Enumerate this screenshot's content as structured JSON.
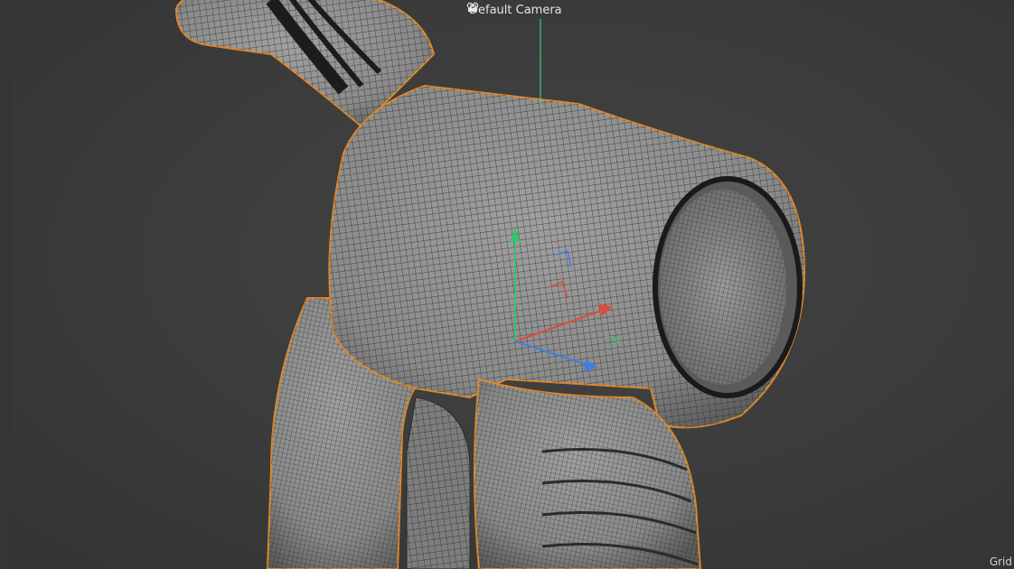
{
  "viewport": {
    "camera_label": "Default Camera",
    "camera_icon": "camera-icon",
    "grid_label": "Grid",
    "colors": {
      "background": "#3a3a3a",
      "mesh_fill": "#8e8e8e",
      "wireframe": "#262626",
      "selection_outline": "#e08a2c",
      "axis_x": "#e04a3a",
      "axis_y": "#39c26a",
      "axis_z": "#3f7fe0"
    }
  }
}
